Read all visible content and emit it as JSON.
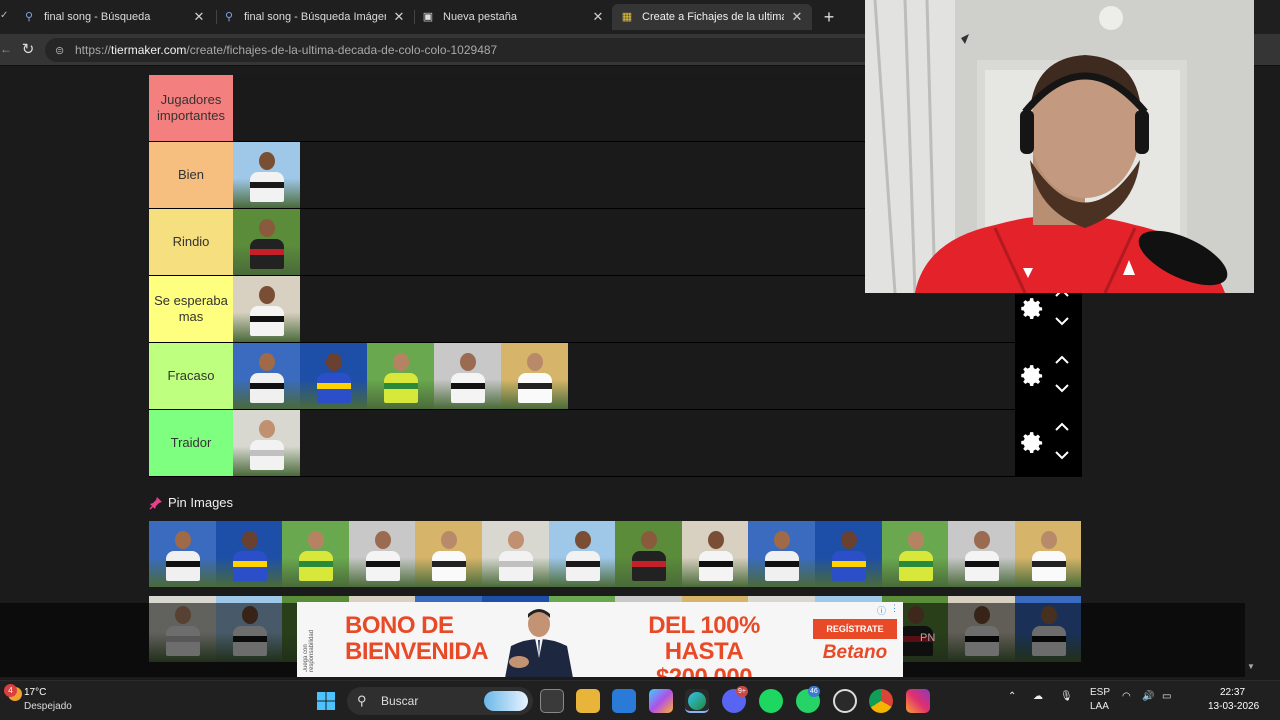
{
  "browser": {
    "tabs": [
      {
        "title": "final song - Búsqueda",
        "icon": "search-icon"
      },
      {
        "title": "final song - Búsqueda Imágenes",
        "icon": "search-icon"
      },
      {
        "title": "Nueva pestaña",
        "icon": "newtab-icon"
      },
      {
        "title": "Create a Fichajes de la ultima deca",
        "icon": "tiermaker-icon",
        "active": true
      }
    ],
    "url_host": "tiermaker.com",
    "url_prefix": "https://",
    "url_path": "/create/fichajes-de-la-ultima-decada-de-colo-colo-1029487"
  },
  "tierlist": {
    "tiers": [
      {
        "label": "Jugadores importantes",
        "color": "#f47f7f",
        "items": 0
      },
      {
        "label": "Bien",
        "color": "#f6bf7f",
        "items": 1
      },
      {
        "label": "Rindio",
        "color": "#f6df7f",
        "items": 1
      },
      {
        "label": "Se esperaba mas",
        "color": "#fefe7f",
        "items": 1
      },
      {
        "label": "Fracaso",
        "color": "#bfff7f",
        "items": 5
      },
      {
        "label": "Traidor",
        "color": "#7fff7f",
        "items": 1
      }
    ]
  },
  "pin": {
    "label": "Pin Images"
  },
  "ad": {
    "left_text_1": "BONO DE",
    "left_text_2": "BIENVENIDA",
    "promo_1": "DEL 100% HASTA",
    "promo_2": "$200.000",
    "cta": "REGÍSTRATE",
    "brand": "Betano",
    "fine_print": "Juega con responsabilidad",
    "accent": "#e84a27"
  },
  "overlay_text": "PN",
  "taskbar": {
    "weather_temp": "17°C",
    "weather_cond": "Despejado",
    "weather_badge": "4",
    "search_placeholder": "Buscar",
    "discord_badge": "9+",
    "whatsapp_badge": "46",
    "lang_1": "ESP",
    "lang_2": "LAA",
    "time": "22:37",
    "date": "13-03-2026"
  }
}
